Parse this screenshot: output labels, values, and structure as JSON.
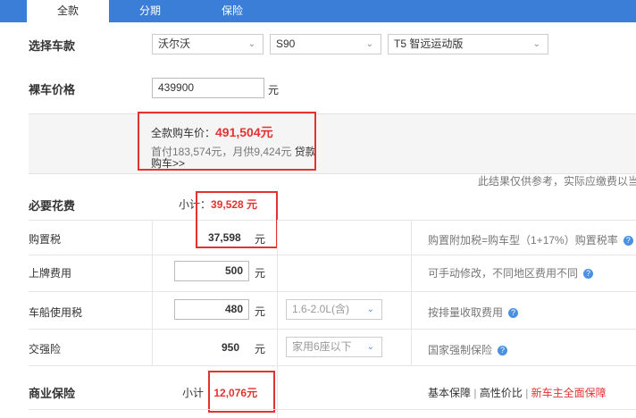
{
  "tabs": [
    {
      "label": "全款"
    },
    {
      "label": "分期"
    },
    {
      "label": "保险"
    }
  ],
  "choose_model": {
    "label": "选择车款",
    "brand": "沃尔沃",
    "series": "S90",
    "trim": "T5 智远运动版"
  },
  "bare_price": {
    "label": "裸车价格",
    "value": "439900",
    "unit": "元"
  },
  "summary": {
    "total_label": "全款购车价：",
    "total_value": "491,504元",
    "loan_line": "首付183,574元，月供9,424元",
    "loan_link": "贷款购车>>"
  },
  "disclaimer": "此结果仅供参考，实际应缴费以当",
  "required": {
    "label": "必要花费",
    "subtotal_label": "小计：",
    "subtotal_value": "39,528 元"
  },
  "purchase_tax": {
    "label": "购置税",
    "value": "37,598",
    "unit": "元",
    "note": "购置附加税=购车型（1+17%）购置税率"
  },
  "plate_fee": {
    "label": "上牌费用",
    "value": "500",
    "unit": "元",
    "note": "可手动修改，不同地区费用不同"
  },
  "vessel_tax": {
    "label": "车船使用税",
    "value": "480",
    "unit": "元",
    "option": "1.6-2.0L(含)",
    "note": "按排量收取费用"
  },
  "compulsory": {
    "label": "交强险",
    "value": "950",
    "unit": "元",
    "option": "家用6座以下",
    "note": "国家强制保险"
  },
  "commercial": {
    "label": "商业保险",
    "subtotal_label": "小计",
    "subtotal_value": "12,076元",
    "links": [
      "基本保障",
      "高性价比",
      "新车主全面保障"
    ],
    "separator": "|"
  },
  "colors": {
    "tab_bar": "#3a7ed8",
    "highlight": "#e23232",
    "help_icon": "#4a90e2"
  }
}
